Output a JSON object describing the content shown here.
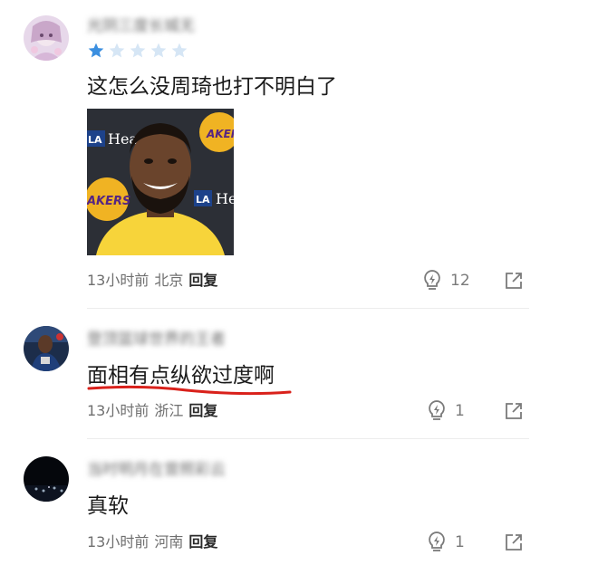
{
  "comments": [
    {
      "username": "光阴三度长城无",
      "rating": 1,
      "rating_max": 5,
      "text": "这怎么没周琦也打不明白了",
      "has_image": true,
      "image_text": {
        "sign_top": "Healt",
        "sign_mid": "He",
        "la": "LA",
        "lakers": "AKER",
        "lakers2": "AKERS"
      },
      "time": "13小时前",
      "location": "北京",
      "reply_label": "回复",
      "likes": "12"
    },
    {
      "username": "登顶篮球世界的王者",
      "text": "面相有点纵欲过度啊",
      "time": "13小时前",
      "location": "浙江",
      "reply_label": "回复",
      "likes": "1"
    },
    {
      "username": "当时明月在曾照彩云",
      "text": "真软",
      "time": "13小时前",
      "location": "河南",
      "reply_label": "回复",
      "likes": "1"
    }
  ],
  "colors": {
    "star_filled": "#3b8fe0",
    "star_empty": "#d6e6f5",
    "underline": "#d9211b",
    "meta_text": "#6f6f6f"
  },
  "icons": {
    "like": "lightbulb-bolt-icon",
    "share": "share-arrow-icon"
  }
}
